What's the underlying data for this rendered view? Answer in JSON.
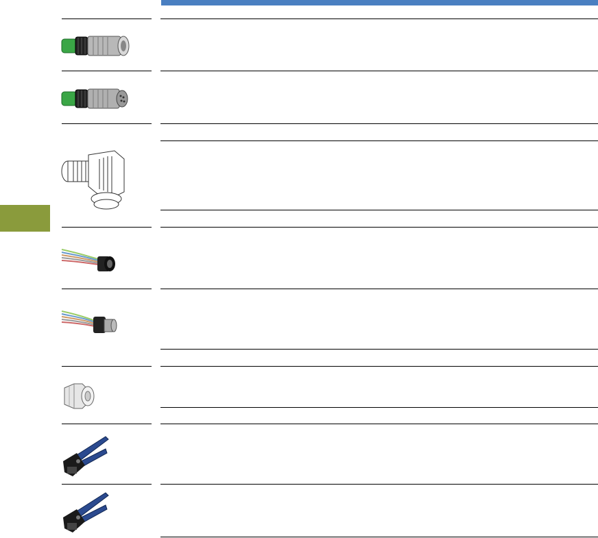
{
  "colors": {
    "header_bar": "#4a7fc1",
    "side_tab": "#8a9b3c",
    "connector_green": "#3aa646",
    "tool_handle": "#2b4a8f"
  },
  "products": [
    {
      "icon": "straight-female-connector-green"
    },
    {
      "icon": "straight-male-connector-green"
    },
    {
      "icon": "right-angle-connector"
    },
    {
      "icon": "prewired-female-socket"
    },
    {
      "icon": "prewired-male-socket"
    },
    {
      "icon": "cable-gland"
    },
    {
      "icon": "crimping-tool"
    },
    {
      "icon": "crimping-tool"
    }
  ]
}
